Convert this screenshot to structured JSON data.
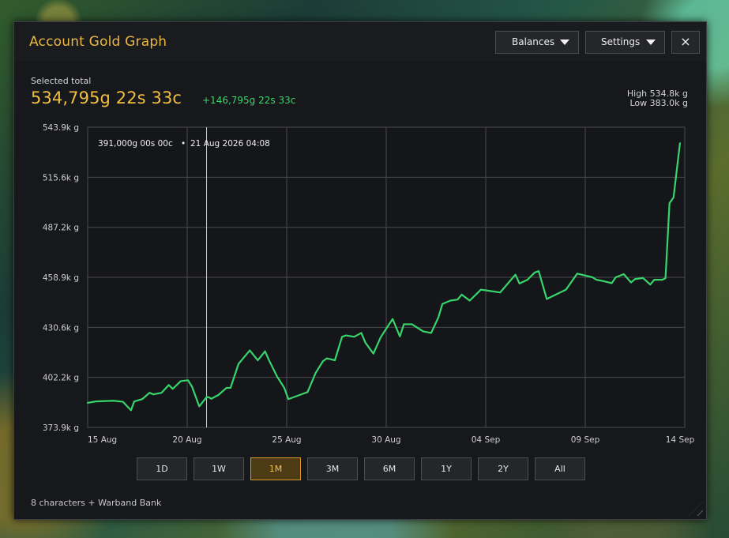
{
  "window": {
    "title": "Account Gold Graph",
    "buttons": {
      "balances": "Balances",
      "settings": "Settings",
      "close": "×"
    }
  },
  "summary": {
    "selected_label": "Selected total",
    "total": "534,795g 22s 33c",
    "delta": "+146,795g 22s 33c",
    "high": "High  534.8k g",
    "low": "Low  383.0k g"
  },
  "tooltip": {
    "value": "391,000g 00s 00c",
    "separator": "•",
    "datetime": "21 Aug 2026 04:08"
  },
  "range_buttons": [
    {
      "label": "1D",
      "selected": false
    },
    {
      "label": "1W",
      "selected": false
    },
    {
      "label": "1M",
      "selected": true
    },
    {
      "label": "3M",
      "selected": false
    },
    {
      "label": "6M",
      "selected": false
    },
    {
      "label": "1Y",
      "selected": false
    },
    {
      "label": "2Y",
      "selected": false
    },
    {
      "label": "All",
      "selected": false
    }
  ],
  "footer": {
    "text": "8 characters + Warband Bank"
  },
  "chart_data": {
    "type": "line",
    "y_unit": "k g",
    "ylim": [
      373.9,
      543.9
    ],
    "y_ticks": [
      "543.9k g",
      "515.6k g",
      "487.2k g",
      "458.9k g",
      "430.6k g",
      "402.2k g",
      "373.9k g"
    ],
    "x_ticks": [
      "15 Aug",
      "20 Aug",
      "25 Aug",
      "30 Aug",
      "04 Sep",
      "09 Sep",
      "14 Sep"
    ],
    "grid": true,
    "series": [
      {
        "x": [
          "2026-08-15 00:00",
          "2026-08-15 10:00",
          "2026-08-16 08:00",
          "2026-08-16 20:00",
          "2026-08-17 06:00",
          "2026-08-17 10:00",
          "2026-08-17 20:00",
          "2026-08-18 05:00",
          "2026-08-18 10:00",
          "2026-08-18 20:00",
          "2026-08-19 05:00",
          "2026-08-19 10:00",
          "2026-08-19 20:00",
          "2026-08-20 05:00",
          "2026-08-20 10:00",
          "2026-08-20 19:00",
          "2026-08-21 04:08",
          "2026-08-21 07:00",
          "2026-08-21 10:00",
          "2026-08-21 19:00",
          "2026-08-22 05:00",
          "2026-08-22 10:00",
          "2026-08-22 20:00",
          "2026-08-23 10:00",
          "2026-08-23 20:00",
          "2026-08-24 05:00",
          "2026-08-24 10:00",
          "2026-08-24 20:00",
          "2026-08-25 05:00",
          "2026-08-25 10:00",
          "2026-08-26 10:00",
          "2026-08-26 20:00",
          "2026-08-27 05:00",
          "2026-08-27 10:00",
          "2026-08-27 20:00",
          "2026-08-28 05:00",
          "2026-08-28 10:00",
          "2026-08-28 20:00",
          "2026-08-29 05:00",
          "2026-08-29 10:00",
          "2026-08-29 20:00",
          "2026-08-30 05:00",
          "2026-08-30 10:00",
          "2026-08-30 20:00",
          "2026-08-31 05:00",
          "2026-08-31 10:00",
          "2026-08-31 20:00",
          "2026-09-01 10:00",
          "2026-09-01 20:00",
          "2026-09-02 05:00",
          "2026-09-02 10:00",
          "2026-09-02 20:00",
          "2026-09-03 05:00",
          "2026-09-03 10:00",
          "2026-09-03 20:00",
          "2026-09-04 10:00",
          "2026-09-05 10:00",
          "2026-09-06 05:00",
          "2026-09-06 10:00",
          "2026-09-06 20:00",
          "2026-09-07 05:00",
          "2026-09-07 10:00",
          "2026-09-07 20:00",
          "2026-09-08 20:00",
          "2026-09-09 10:00",
          "2026-09-10 05:00",
          "2026-09-10 10:00",
          "2026-09-10 20:00",
          "2026-09-11 05:00",
          "2026-09-11 10:00",
          "2026-09-11 20:00",
          "2026-09-12 05:00",
          "2026-09-12 10:00",
          "2026-09-12 20:00",
          "2026-09-13 05:00",
          "2026-09-13 10:00",
          "2026-09-13 20:00",
          "2026-09-14 00:00",
          "2026-09-14 05:00",
          "2026-09-14 10:00",
          "2026-09-14 18:00"
        ],
        "y": [
          387.8,
          388.6,
          389.0,
          388.4,
          383.6,
          388.6,
          389.9,
          393.5,
          392.6,
          393.5,
          397.9,
          395.7,
          400.1,
          400.6,
          397.0,
          385.8,
          391.0,
          391.0,
          390.1,
          392.3,
          396.3,
          396.3,
          409.9,
          417.5,
          411.9,
          417.0,
          411.9,
          402.7,
          396.3,
          389.9,
          393.9,
          404.7,
          411.3,
          413.0,
          411.9,
          425.2,
          426.0,
          425.2,
          427.4,
          421.9,
          415.7,
          424.8,
          428.4,
          435.3,
          425.4,
          432.3,
          432.3,
          428.3,
          427.4,
          436.2,
          443.8,
          445.7,
          446.3,
          449.1,
          445.7,
          451.9,
          450.3,
          460.4,
          455.4,
          457.5,
          461.6,
          462.4,
          446.6,
          451.9,
          461.0,
          458.9,
          457.5,
          456.6,
          455.6,
          458.9,
          460.7,
          456.0,
          457.9,
          458.5,
          454.8,
          457.5,
          457.5,
          458.4,
          500.9,
          504.1,
          534.8
        ]
      }
    ]
  },
  "colors": {
    "accent_gold": "#ebb841",
    "line_green": "#37d56b",
    "panel_bg": "#17181b",
    "selected_range": "#d89b2b"
  }
}
